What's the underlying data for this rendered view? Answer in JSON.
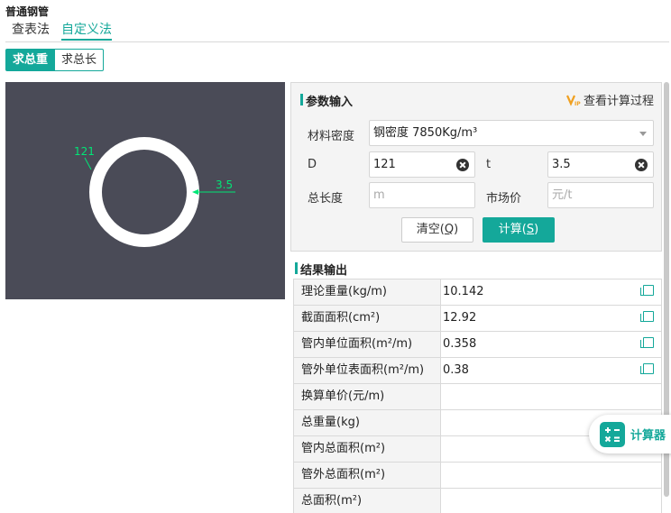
{
  "page": {
    "title": "普通钢管"
  },
  "tabs": [
    {
      "label": "查表法",
      "active": false
    },
    {
      "label": "自定义法",
      "active": true
    }
  ],
  "modes": [
    {
      "label": "求总重",
      "active": true
    },
    {
      "label": "求总长",
      "active": false
    }
  ],
  "diagram": {
    "diameter_label": "121",
    "thickness_label": "3.5",
    "colors": {
      "background": "#4a4b57",
      "pipe": "#ffffff",
      "dimension": "#00e676"
    }
  },
  "params": {
    "title": "参数输入",
    "calc_process_link": "查看计算过程",
    "density": {
      "label": "材料密度",
      "value": "钢密度 7850Kg/m³"
    },
    "D": {
      "label": "D",
      "value": "121"
    },
    "t": {
      "label": "t",
      "value": "3.5"
    },
    "total_length": {
      "label": "总长度",
      "placeholder": "m"
    },
    "market_price": {
      "label": "市场价",
      "placeholder": "元/t"
    },
    "clear_button": {
      "text": "清空(",
      "key": "Q",
      "close": ")"
    },
    "calc_button": {
      "text": "计算(",
      "key": "S",
      "close": ")"
    }
  },
  "results": {
    "title": "结果输出",
    "rows": [
      {
        "label": "理论重量(kg/m)",
        "value": "10.142",
        "copy": true
      },
      {
        "label": "截面面积(cm²)",
        "value": "12.92",
        "copy": true
      },
      {
        "label": "管内单位面积(m²/m)",
        "value": "0.358",
        "copy": true
      },
      {
        "label": "管外单位表面积(m²/m)",
        "value": "0.38",
        "copy": true
      },
      {
        "label": "换算单价(元/m)",
        "value": "",
        "copy": false
      },
      {
        "label": "总重量(kg)",
        "value": "",
        "copy": false
      },
      {
        "label": "管内总面积(m²)",
        "value": "",
        "copy": false
      },
      {
        "label": "管外总面积(m²)",
        "value": "",
        "copy": false
      },
      {
        "label": "总面积(m²)",
        "value": "",
        "copy": false
      }
    ]
  },
  "widget": {
    "label": "计算器"
  },
  "theme": {
    "accent": "#14a89a"
  }
}
